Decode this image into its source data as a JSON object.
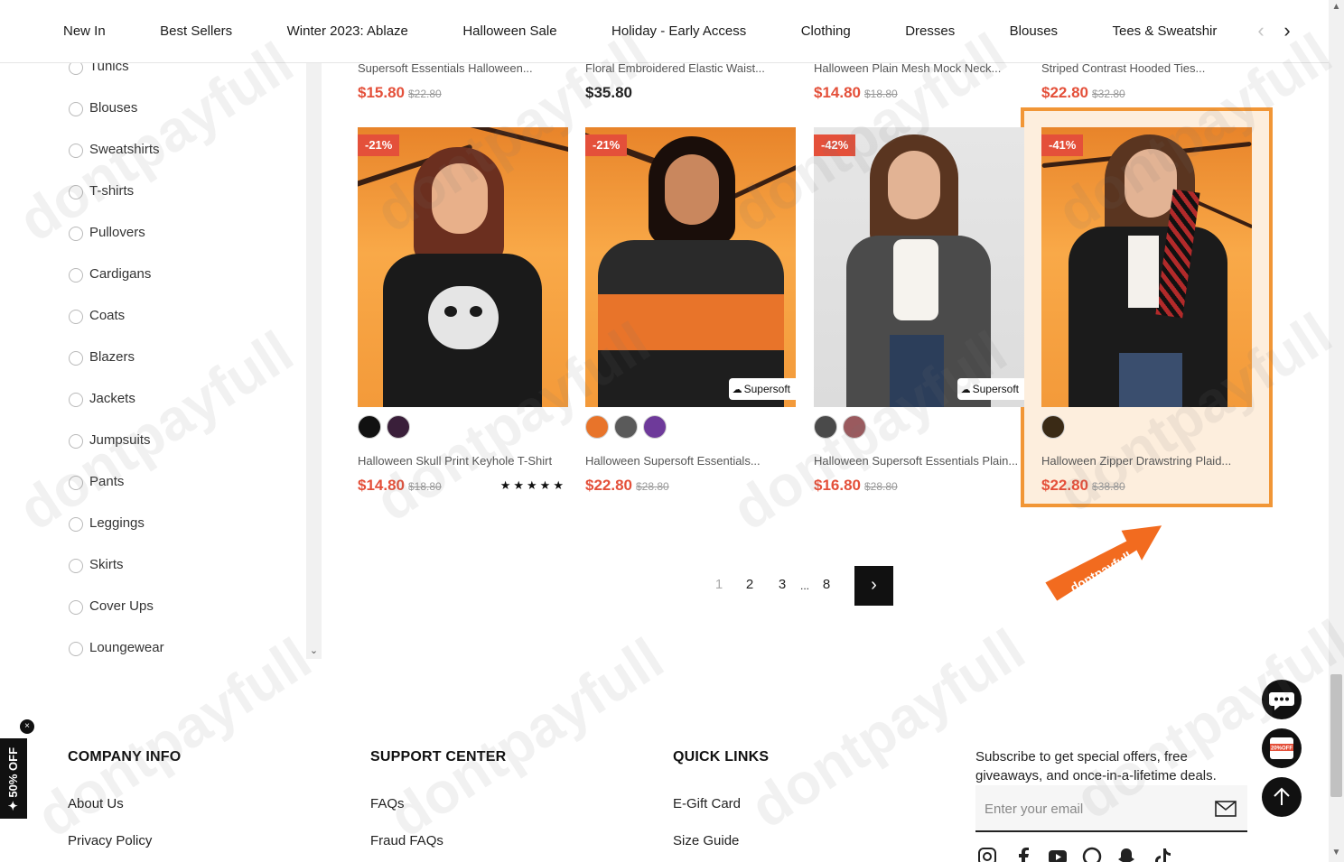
{
  "nav": {
    "items": [
      "New In",
      "Best Sellers",
      "Winter 2023: Ablaze",
      "Halloween Sale",
      "Holiday - Early Access",
      "Clothing",
      "Dresses",
      "Blouses",
      "Tees & Sweatshir"
    ],
    "prev_icon": "chevron-left-icon",
    "next_icon": "chevron-right-icon"
  },
  "sidebar": {
    "filters": [
      "Tunics",
      "Blouses",
      "Sweatshirts",
      "T-shirts",
      "Pullovers",
      "Cardigans",
      "Coats",
      "Blazers",
      "Jackets",
      "Jumpsuits",
      "Pants",
      "Leggings",
      "Skirts",
      "Cover Ups",
      "Loungewear"
    ]
  },
  "prev_row": [
    {
      "title": "Supersoft Essentials Halloween...",
      "price": "$15.80",
      "original_price": "$22.80"
    },
    {
      "title": "Floral Embroidered Elastic Waist...",
      "price": "$35.80",
      "original_price": ""
    },
    {
      "title": "Halloween Plain Mesh Mock Neck...",
      "price": "$14.80",
      "original_price": "$18.80"
    },
    {
      "title": "Striped Contrast Hooded Ties...",
      "price": "$22.80",
      "original_price": "$32.80"
    }
  ],
  "products": [
    {
      "badge": "-21%",
      "title": "Halloween Skull Print Keyhole T-Shirt",
      "price": "$14.80",
      "original_price": "$18.80",
      "tag": "",
      "rating": 5,
      "stars": "★★★★★",
      "swatches": [
        "#111111",
        "#3a1f3a"
      ]
    },
    {
      "badge": "-21%",
      "title": "Halloween Supersoft Essentials...",
      "price": "$22.80",
      "original_price": "$28.80",
      "tag": "Supersoft",
      "rating": null,
      "stars": "",
      "swatches": [
        "#e8742a",
        "#5a5a5a",
        "#6e3a9a"
      ]
    },
    {
      "badge": "-42%",
      "title": "Halloween Supersoft Essentials Plain...",
      "price": "$16.80",
      "original_price": "$28.80",
      "tag": "Supersoft",
      "rating": null,
      "stars": "",
      "swatches": [
        "#4a4a4a",
        "#9a5a5e"
      ]
    },
    {
      "badge": "-41%",
      "title": "Halloween Zipper Drawstring Plaid...",
      "price": "$22.80",
      "original_price": "$38.80",
      "tag": "",
      "rating": null,
      "stars": "",
      "swatches": [
        "#3a2a15"
      ]
    }
  ],
  "pagination": {
    "pages": [
      "1",
      "2",
      "3",
      "...",
      "8"
    ],
    "current": "1",
    "next": "›"
  },
  "annotation": {
    "arrow_text": "dontpayfull"
  },
  "footer": {
    "company": {
      "heading": "COMPANY INFO",
      "links": [
        "About Us",
        "Privacy Policy"
      ]
    },
    "support": {
      "heading": "SUPPORT CENTER",
      "links": [
        "FAQs",
        "Fraud FAQs"
      ]
    },
    "quick": {
      "heading": "QUICK LINKS",
      "links": [
        "E-Gift Card",
        "Size Guide"
      ]
    },
    "subscribe_text": "Subscribe to get special offers, free giveaways, and once-in-a-lifetime deals.",
    "email_placeholder": "Enter your email",
    "social_icons": [
      "instagram-icon",
      "facebook-icon",
      "youtube-icon",
      "pinterest-icon",
      "snapchat-icon",
      "tiktok-icon"
    ]
  },
  "promo_tab": {
    "label": "✦ 50% OFF",
    "close": "×"
  },
  "floating": {
    "coupon_label": "20%OFF"
  },
  "watermark": "dontpayfull",
  "colors": {
    "sale": "#e4503a",
    "highlight": "#f19636",
    "highlight_bg": "#fdeedd"
  }
}
